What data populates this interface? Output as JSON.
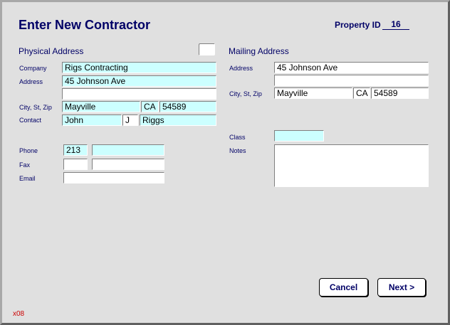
{
  "title": "Enter New Contractor",
  "property_id": {
    "label": "Property ID",
    "value": "16"
  },
  "physical": {
    "heading": "Physical Address",
    "company_label": "Company",
    "company": "Rigs Contracting",
    "address_label": "Address",
    "address1": "45 Johnson Ave",
    "address2": "",
    "csz_label": "City, St, Zip",
    "city": "Mayville",
    "state": "CA",
    "zip": "54589",
    "contact_label": "Contact",
    "contact_first": "John",
    "contact_mi": "J",
    "contact_last": "Riggs",
    "phone_label": "Phone",
    "phone_area": "213",
    "phone_number": "",
    "fax_label": "Fax",
    "fax_area": "",
    "fax_number": "",
    "email_label": "Email",
    "email": ""
  },
  "mailing": {
    "heading": "Mailing Address",
    "address_label": "Address",
    "address1": "45 Johnson Ave",
    "address2": "",
    "csz_label": "City, St, Zip",
    "city": "Mayville",
    "state": "CA",
    "zip": "54589",
    "class_label": "Class",
    "class_value": "",
    "notes_label": "Notes",
    "notes": ""
  },
  "buttons": {
    "cancel": "Cancel",
    "next": "Next >"
  },
  "form_code": "x08",
  "colors": {
    "accent": "#000066",
    "field_fill": "#ccffff",
    "background": "#e0e0e0",
    "code": "#cc0000"
  }
}
